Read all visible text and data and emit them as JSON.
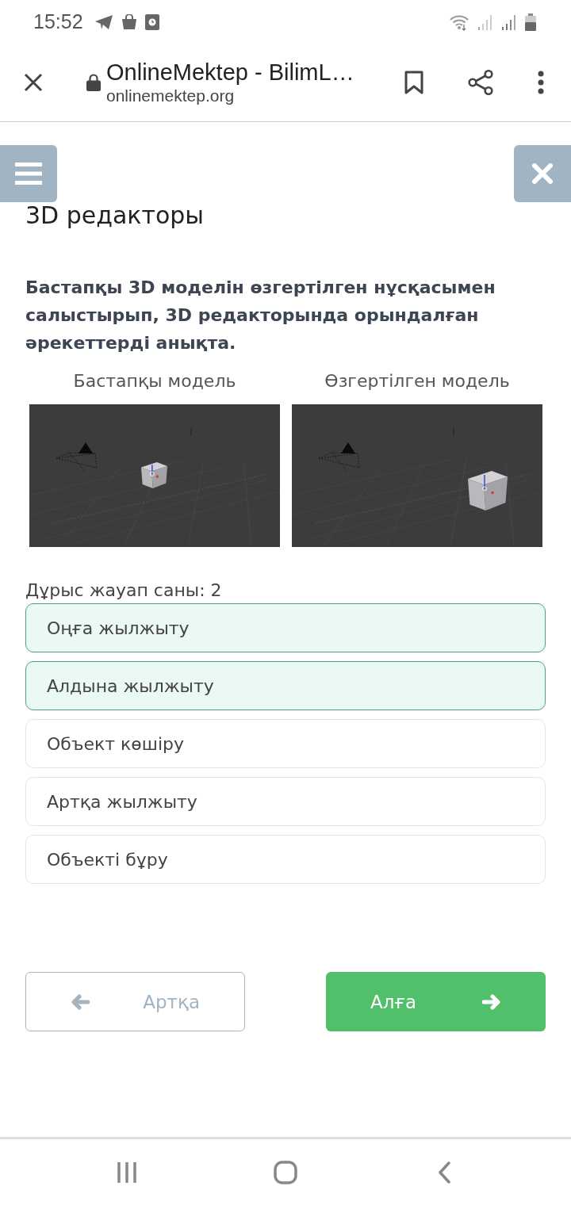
{
  "status_bar": {
    "time": "15:52"
  },
  "browser": {
    "title": "OnlineMektep - BilimL…",
    "url": "onlinemektep.org"
  },
  "page": {
    "title": "3D редакторы",
    "question": "Бастапқы 3D моделін өзгертілген нұсқасымен салыстырып, 3D редакторында орындалған әрекеттерді анықта.",
    "images": [
      {
        "caption": "Бастапқы модель"
      },
      {
        "caption": "Өзгертілген модель"
      }
    ],
    "answer_count": "Дұрыс жауап саны: 2",
    "options": [
      {
        "label": "Оңға жылжыту",
        "selected": true
      },
      {
        "label": "Алдына жылжыту",
        "selected": true
      },
      {
        "label": "Объект көшіру",
        "selected": false
      },
      {
        "label": "Артқа жылжыту",
        "selected": false
      },
      {
        "label": "Объекті бұру",
        "selected": false
      }
    ],
    "buttons": [
      {
        "kind": "back",
        "label": "Артқа",
        "disabled": true
      },
      {
        "kind": "next",
        "label": "Алға",
        "disabled": false
      }
    ]
  }
}
